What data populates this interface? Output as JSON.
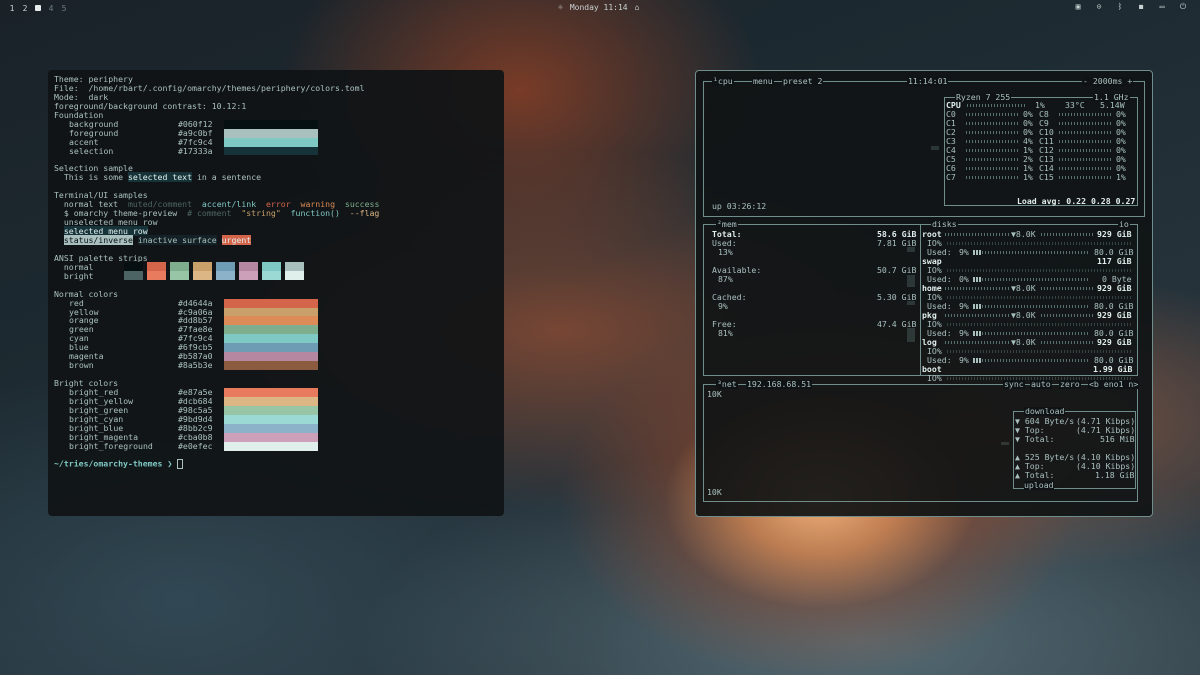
{
  "topbar": {
    "workspaces": [
      "1",
      "2",
      "4",
      "5"
    ],
    "clock": "Monday 11:14",
    "tray_icons": [
      "omarchy-logo-icon",
      "screen-record-icon",
      "bluetooth-icon",
      "speaker-icon",
      "battery-icon",
      "power-icon"
    ]
  },
  "terminal": {
    "theme_line": "Theme: periphery",
    "file_line": "File:  /home/rbart/.config/omarchy/themes/periphery/colors.toml",
    "mode_line": "Mode:  dark",
    "contrast_line": "foreground/background contrast: 10.12:1",
    "foundation_title": "Foundation",
    "foundation": [
      {
        "name": "background",
        "hex": "#060f12",
        "color": "#060f12"
      },
      {
        "name": "foreground",
        "hex": "#a9c0bf",
        "color": "#a9c0bf"
      },
      {
        "name": "accent",
        "hex": "#7fc9c4",
        "color": "#7fc9c4"
      },
      {
        "name": "selection",
        "hex": "#17333a",
        "color": "#17333a"
      }
    ],
    "selection_title": "Selection sample",
    "selection_pre": "  This is some ",
    "selection_highlight": "selected text",
    "selection_post": " in a sentence",
    "ui_title": "Terminal/UI samples",
    "ui_normal": "normal text",
    "ui_muted": "muted/comment",
    "ui_accent": "accent/link",
    "ui_error": "error",
    "ui_warning": "warning",
    "ui_success": "success",
    "cmd_prompt": "$ omarchy theme-preview",
    "cmd_comment": "# comment",
    "cmd_string": "\"string\"",
    "cmd_function": "function()",
    "cmd_flag": "--flag",
    "menu_unselected": "unselected menu row",
    "menu_selected": "selected menu row",
    "status_inverse": "status/inverse",
    "inactive_surface": "inactive surface",
    "urgent": "urgent",
    "ansi_title": "ANSI palette strips",
    "ansi_normal_label": "normal",
    "ansi_bright_label": "bright",
    "ansi_normal": [
      "#060f12",
      "#d4644a",
      "#7fae8e",
      "#c9a06a",
      "#6f9cb5",
      "#b587a0",
      "#7fc9c4",
      "#a9c0bf"
    ],
    "ansi_bright": [
      "#4c6464",
      "#e87a5e",
      "#98c5a5",
      "#dcb684",
      "#8bb2c9",
      "#cba0b8",
      "#9bd9d4",
      "#e0efec"
    ],
    "normal_title": "Normal colors",
    "normal_colors": [
      {
        "name": "red",
        "hex": "#d4644a"
      },
      {
        "name": "yellow",
        "hex": "#c9a06a"
      },
      {
        "name": "orange",
        "hex": "#dd8b57"
      },
      {
        "name": "green",
        "hex": "#7fae8e"
      },
      {
        "name": "cyan",
        "hex": "#7fc9c4"
      },
      {
        "name": "blue",
        "hex": "#6f9cb5"
      },
      {
        "name": "magenta",
        "hex": "#b587a0"
      },
      {
        "name": "brown",
        "hex": "#8a5b3e"
      }
    ],
    "bright_title": "Bright colors",
    "bright_colors": [
      {
        "name": "bright_red",
        "hex": "#e87a5e"
      },
      {
        "name": "bright_yellow",
        "hex": "#dcb684"
      },
      {
        "name": "bright_green",
        "hex": "#98c5a5"
      },
      {
        "name": "bright_cyan",
        "hex": "#9bd9d4"
      },
      {
        "name": "bright_blue",
        "hex": "#8bb2c9"
      },
      {
        "name": "bright_magenta",
        "hex": "#cba0b8"
      },
      {
        "name": "bright_foreground",
        "hex": "#e0efec"
      }
    ],
    "prompt": "~/tries/omarchy-themes ❯"
  },
  "btop": {
    "cpu_title": "¹cpu",
    "menu": "menu",
    "preset": "preset 2",
    "time": "11:14:01",
    "interval": "- 2000ms +",
    "cpu_model": "Ryzen 7 255",
    "cpu_freq": "1.1 GHz",
    "cpu_label": "CPU",
    "cpu_pct": "1%",
    "cpu_temp": "33°C",
    "cpu_power": "5.14W",
    "cores_left": [
      {
        "name": "C0",
        "pct": "0%"
      },
      {
        "name": "C1",
        "pct": "0%"
      },
      {
        "name": "C2",
        "pct": "0%"
      },
      {
        "name": "C3",
        "pct": "4%"
      },
      {
        "name": "C4",
        "pct": "1%"
      },
      {
        "name": "C5",
        "pct": "2%"
      },
      {
        "name": "C6",
        "pct": "1%"
      },
      {
        "name": "C7",
        "pct": "1%"
      }
    ],
    "cores_right": [
      {
        "name": "C8",
        "pct": "0%"
      },
      {
        "name": "C9",
        "pct": "0%"
      },
      {
        "name": "C10",
        "pct": "0%"
      },
      {
        "name": "C11",
        "pct": "0%"
      },
      {
        "name": "C12",
        "pct": "0%"
      },
      {
        "name": "C13",
        "pct": "0%"
      },
      {
        "name": "C14",
        "pct": "0%"
      },
      {
        "name": "C15",
        "pct": "1%"
      }
    ],
    "load_avg": "Load avg: 0.22 0.28 0.27",
    "uptime": "up 03:26:12",
    "mem_title": "²mem",
    "mem": {
      "total_label": "Total:",
      "total_val": "58.6 GiB",
      "used_label": "Used:",
      "used_val": "7.81 GiB",
      "used_pct": "13%",
      "avail_label": "Available:",
      "avail_val": "50.7 GiB",
      "avail_pct": "87%",
      "cached_label": "Cached:",
      "cached_val": "5.30 GiB",
      "cached_pct": "9%",
      "free_label": "Free:",
      "free_val": "47.4 GiB",
      "free_pct": "81%"
    },
    "disks_title": "disks",
    "io_title": "io",
    "disks": [
      {
        "name": "root",
        "io": "▼8.0K",
        "size": "929 GiB",
        "used": "9%",
        "used_val": "80.0 GiB"
      },
      {
        "name": "swap",
        "io": "",
        "size": "117 GiB",
        "used": "0%",
        "used_val": "0 Byte"
      },
      {
        "name": "home",
        "io": "▼8.0K",
        "size": "929 GiB",
        "used": "9%",
        "used_val": "80.0 GiB"
      },
      {
        "name": "pkg",
        "io": "▼8.0K",
        "size": "929 GiB",
        "used": "9%",
        "used_val": "80.0 GiB"
      },
      {
        "name": "log",
        "io": "▼8.0K",
        "size": "929 GiB",
        "used": "9%",
        "used_val": "80.0 GiB"
      },
      {
        "name": "boot",
        "io": "",
        "size": "1.99 GiB",
        "used": "",
        "used_val": ""
      }
    ],
    "io_label": "IO%",
    "used_label": "Used:",
    "net_title": "³net",
    "net_ip": "192.168.68.51",
    "net_sync": "sync",
    "net_auto": "auto",
    "net_zero": "zero",
    "net_iface": "<b eno1 n>",
    "net_scale_top": "10K",
    "net_scale_bottom": "10K",
    "download_title": "download",
    "dl_rate": "▼ 604 Byte/s",
    "dl_rate_bits": "(4.71 Kibps)",
    "dl_top_label": "▼ Top:",
    "dl_top_bits": "(4.71 Kibps)",
    "dl_total_label": "▼ Total:",
    "dl_total": "516 MiB",
    "ul_rate": "▲ 525 Byte/s",
    "ul_rate_bits": "(4.10 Kibps)",
    "ul_top_label": "▲ Top:",
    "ul_top_bits": "(4.10 Kibps)",
    "ul_total_label": "▲ Total:",
    "ul_total": "1.18 GiB",
    "upload_title": "upload"
  }
}
